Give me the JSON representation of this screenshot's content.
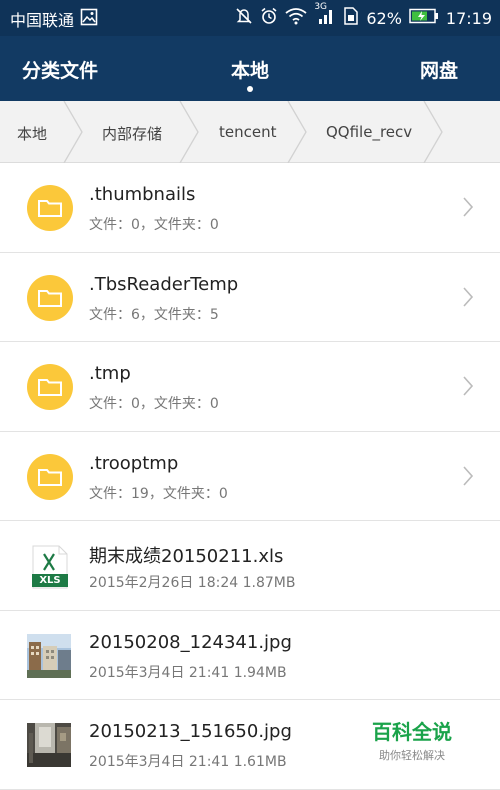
{
  "status_bar": {
    "carrier": "中国联通",
    "network": "3G",
    "battery": "62%",
    "time": "17:19"
  },
  "tabs": {
    "left": "分类文件",
    "center": "本地",
    "right": "网盘"
  },
  "breadcrumb": [
    "本地",
    "内部存储",
    "tencent",
    "QQfile_recv"
  ],
  "files": [
    {
      "name": ".thumbnails",
      "meta": "文件：0，文件夹：0",
      "type": "folder"
    },
    {
      "name": ".TbsReaderTemp",
      "meta": "文件：6，文件夹：5",
      "type": "folder"
    },
    {
      "name": ".tmp",
      "meta": "文件：0，文件夹：0",
      "type": "folder"
    },
    {
      "name": ".trooptmp",
      "meta": "文件：19，文件夹：0",
      "type": "folder"
    },
    {
      "name": "期末成绩20150211.xls",
      "meta": "2015年2月26日 18:24 1.87MB",
      "type": "xls",
      "icon_label": "XLS"
    },
    {
      "name": "20150208_124341.jpg",
      "meta": "2015年3月4日 21:41 1.94MB",
      "type": "image"
    },
    {
      "name": "20150213_151650.jpg",
      "meta": "2015年3月4日 21:41 1.61MB",
      "type": "image"
    }
  ],
  "watermark": {
    "title": "百科全说",
    "subtitle": "助你轻松解决"
  },
  "colors": {
    "header": "#123a63",
    "status": "#0f3358",
    "folder": "#fbc83a",
    "xls_green": "#1d7a45",
    "watermark_green": "#1aa34a"
  }
}
